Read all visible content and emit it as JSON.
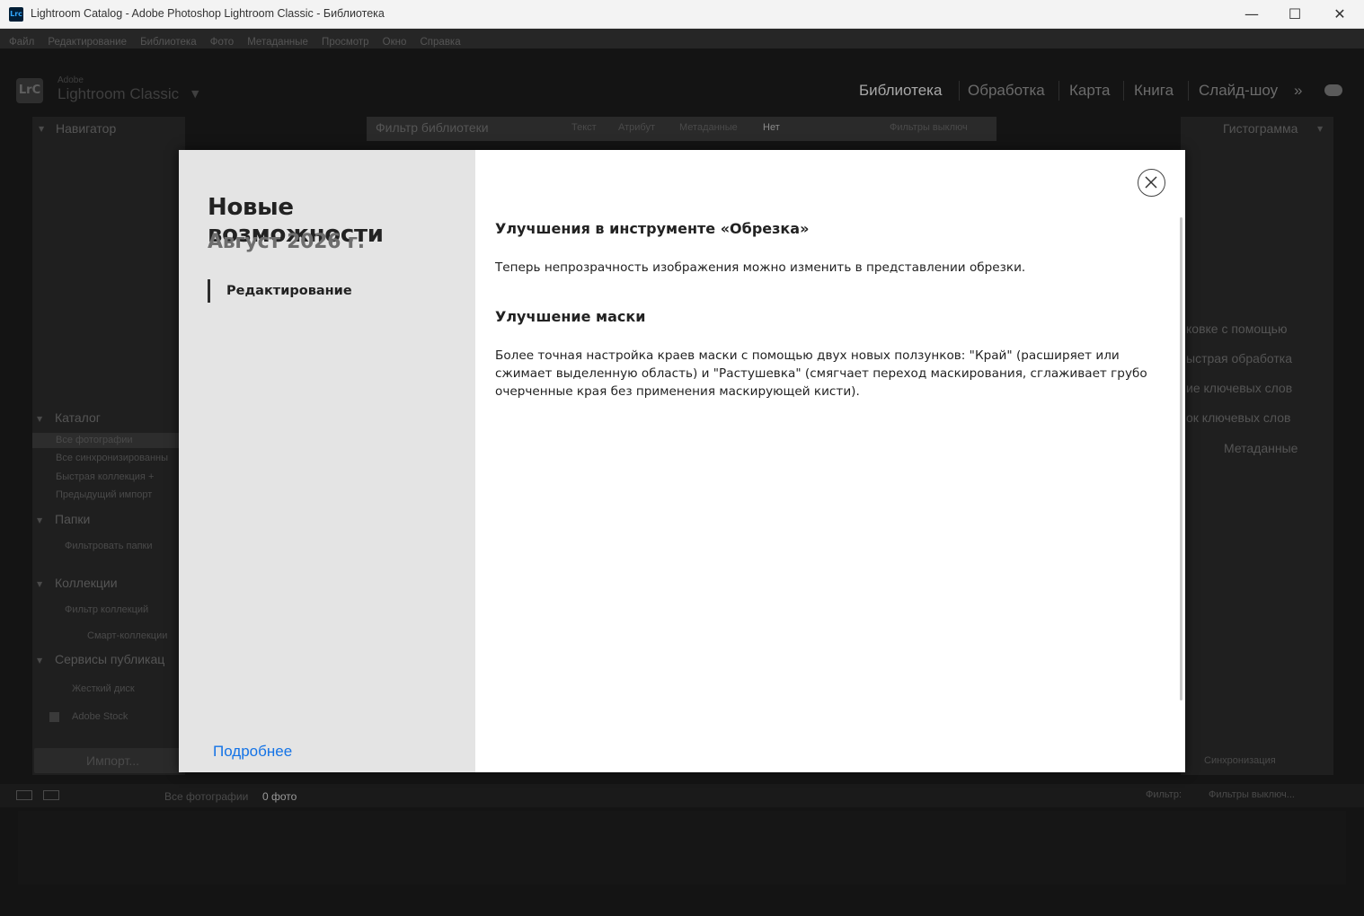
{
  "window": {
    "title": "Lightroom Catalog - Adobe Photoshop Lightroom Classic - Библиотека",
    "app_icon": "Lrc",
    "minimize": "—",
    "maximize": "☐",
    "close": "✕"
  },
  "menu": [
    "Файл",
    "Редактирование",
    "Библиотека",
    "Фото",
    "Метаданные",
    "Просмотр",
    "Окно",
    "Справка"
  ],
  "identity": {
    "logo": "LrC",
    "brand_small": "Adobe",
    "brand_big": "Lightroom Classic",
    "arrow": "▼"
  },
  "modules": [
    "Библиотека",
    "Обработка",
    "Карта",
    "Книга",
    "Слайд-шоу"
  ],
  "modules_more": "»",
  "left_panel": {
    "navigator": "Навигатор",
    "catalog": "Каталог",
    "catalog_items": [
      "Все фотографии",
      "Все синхронизированны",
      "Быстрая коллекция +",
      "Предыдущий импорт"
    ],
    "folders": "Папки",
    "folders_filter": "Фильтровать папки",
    "collections": "Коллекции",
    "collections_filter": "Фильтр коллекций",
    "smart_collections": "Смарт-коллекции",
    "publish": "Сервисы публикац",
    "publish_items": [
      "Жесткий диск",
      "Adobe Stock"
    ],
    "import_button": "Импорт..."
  },
  "filter_bar": {
    "label": "Фильтр библиотеки",
    "options": [
      "Текст",
      "Атрибут",
      "Метаданные",
      "Нет"
    ],
    "preset": "Фильтры выключ"
  },
  "right_panel": {
    "histogram": "Гистограмма",
    "items": [
      "ковке с помощью",
      "ыстрая обработка",
      "ие ключевых слов",
      "ок ключевых слов",
      "Метаданные"
    ],
    "sync": "Синхронизация"
  },
  "filmstrip": {
    "source": "Все фотографии",
    "count": "0 фото",
    "filter_label": "Фильтр:",
    "filter_value": "Фильтры выключ..."
  },
  "dialog": {
    "title": "Новые возможности",
    "subtitle": "Август 2026 г.",
    "nav_item": "Редактирование",
    "learn_more": "Подробнее",
    "sections": [
      {
        "title": "Улучшения в инструменте «Обрезка»",
        "body": "Теперь непрозрачность изображения можно изменить в представлении обрезки."
      },
      {
        "title": "Улучшение маски",
        "body": "Более точная настройка краев маски с помощью двух новых ползунков: \"Край\" (расширяет или сжимает выделенную область) и \"Растушевка\" (смягчает переход маскирования, сглаживает грубо очерченные края без применения маскирующей кисти)."
      }
    ]
  }
}
